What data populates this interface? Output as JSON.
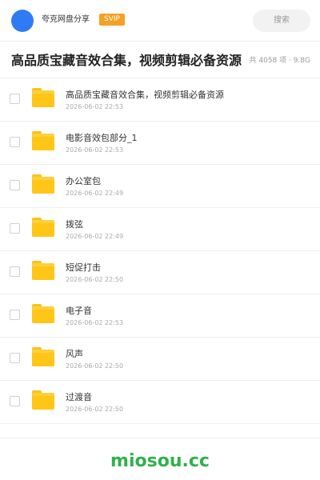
{
  "header": {
    "app_name": "夸克网盘分享",
    "badge": "SVIP",
    "search_label": "搜索",
    "avatar_color": "#2f7bf5",
    "badge_color": "#f6a023"
  },
  "share": {
    "title": "高品质宝藏音效合集，视频剪辑必备资源",
    "meta": "共 4058 项 · 9.8G"
  },
  "files": [
    {
      "icon": "folder-icon",
      "name": "高品质宝藏音效合集，视频剪辑必备资源",
      "date": "2026-06-02 22:53"
    },
    {
      "icon": "folder-icon",
      "name": "电影音效包部分_1",
      "date": "2026-06-02 22:53"
    },
    {
      "icon": "folder-icon",
      "name": "办公室包",
      "date": "2026-06-02 22:49"
    },
    {
      "icon": "folder-icon",
      "name": "拨弦",
      "date": "2026-06-02 22:49"
    },
    {
      "icon": "folder-icon",
      "name": "短促打击",
      "date": "2026-06-02 22:50"
    },
    {
      "icon": "folder-icon",
      "name": "电子音",
      "date": "2026-06-02 22:53"
    },
    {
      "icon": "folder-icon",
      "name": "风声",
      "date": "2026-06-02 22:50"
    },
    {
      "icon": "folder-icon",
      "name": "过渡音",
      "date": "2026-06-02 22:50"
    }
  ],
  "footer": {
    "brand": "miosou.cc",
    "brand_color": "#2fb14a"
  }
}
